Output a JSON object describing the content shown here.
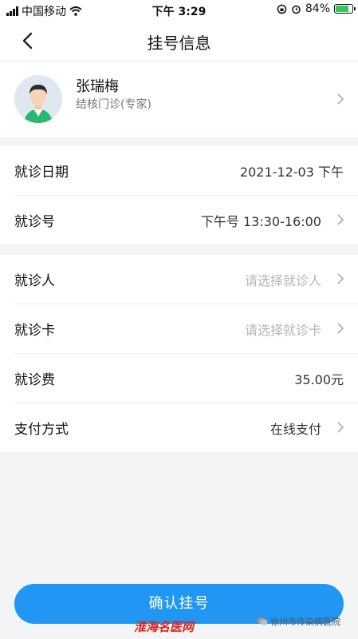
{
  "status_bar": {
    "carrier": "中国移动",
    "time": "下午 3:29",
    "battery": "84%",
    "battery_level": 0.84
  },
  "nav": {
    "title": "挂号信息"
  },
  "doctor": {
    "name": "张瑞梅",
    "dept": "结核门诊(专家)"
  },
  "schedule": {
    "date_label": "就诊日期",
    "date_value": "2021-12-03 下午",
    "slot_label": "就诊号",
    "slot_value": "下午号 13:30-16:00"
  },
  "patient": {
    "person_label": "就诊人",
    "person_placeholder": "请选择就诊人",
    "card_label": "就诊卡",
    "card_placeholder": "请选择就诊卡",
    "fee_label": "就诊费",
    "fee_value": "35.00元",
    "pay_label": "支付方式",
    "pay_value": "在线支付"
  },
  "confirm_label": "确认挂号",
  "watermark": {
    "left": "淮海名医网",
    "right": "徐州市传染病医院"
  },
  "colors": {
    "accent": "#2196f3",
    "battery_fill": "#34c759"
  }
}
